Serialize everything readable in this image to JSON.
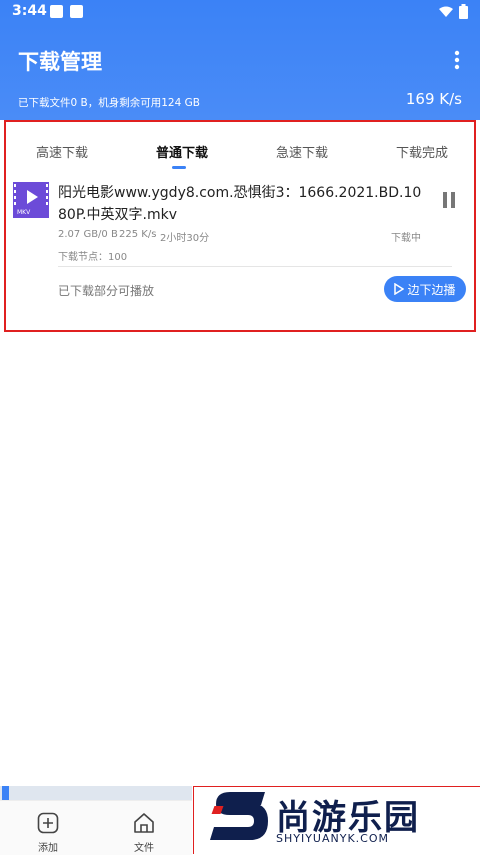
{
  "status": {
    "time": "3:44"
  },
  "header": {
    "title": "下载管理",
    "storage_text": "已下载文件0 B，机身剩余可用124 GB",
    "speed": "169 K/s"
  },
  "tabs": [
    {
      "label": "高速下载"
    },
    {
      "label": "普通下载"
    },
    {
      "label": "急速下载"
    },
    {
      "label": "下载完成"
    }
  ],
  "download": {
    "file_badge": "MKV",
    "name": "阳光电影www.ygdy8.com.恐惧街3：1666.2021.BD.1080P.中英双字.mkv",
    "size": "2.07 GB/0 B",
    "rate": "225 K/s",
    "remaining": "2小时30分",
    "state": "下载中",
    "nodes": "下载节点：100",
    "partial_note": "已下载部分可播放",
    "play_label": "边下边播"
  },
  "bottom_nav": [
    {
      "label": "添加"
    },
    {
      "label": "文件"
    }
  ],
  "watermark": {
    "name": "尚游乐园",
    "url": "SHYIYUANYK.COM"
  },
  "colors": {
    "accent": "#3b82f6",
    "file_icon": "#6c4bd8",
    "highlight": "#e02020"
  }
}
